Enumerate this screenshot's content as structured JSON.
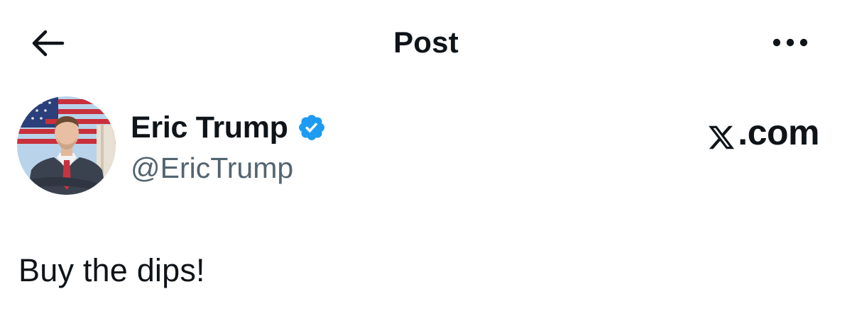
{
  "header": {
    "back_icon": "arrow-left-icon",
    "title": "Post",
    "more_icon": "ellipsis-horizontal-icon"
  },
  "author": {
    "display_name": "Eric Trump",
    "handle": "@EricTrump",
    "verified": true,
    "verified_icon": "verified-badge-icon",
    "verified_color": "#1d9bf0"
  },
  "watermark": {
    "brand_icon": "x-logo-icon",
    "text": ".com"
  },
  "tweet": {
    "text": "Buy the dips!"
  },
  "colors": {
    "text_primary": "#0f1419",
    "text_secondary": "#536471",
    "background": "#ffffff",
    "accent": "#1d9bf0"
  }
}
